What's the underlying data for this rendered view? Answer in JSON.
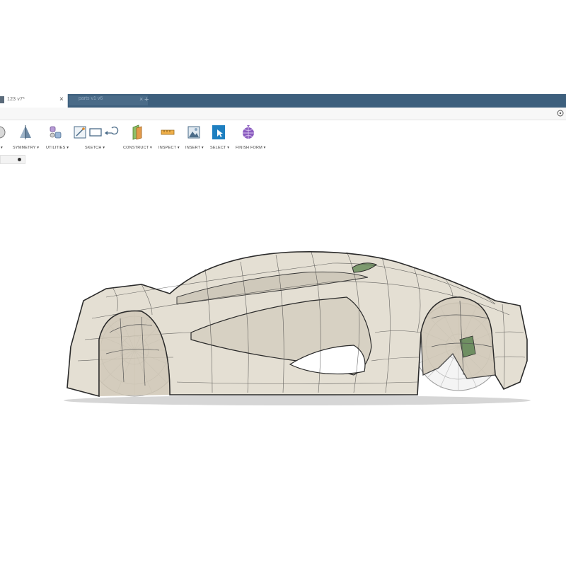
{
  "tabs": {
    "active_label": "123 v7*",
    "inactive_label": "parts v1 v6",
    "close_glyph": "×",
    "add_glyph": "+"
  },
  "toolbar": {
    "groups": [
      {
        "label": "▾",
        "icon": "partial-create-icon"
      },
      {
        "label": "SYMMETRY ▾",
        "icon": "symmetry-icon"
      },
      {
        "label": "UTILITIES ▾",
        "icon": "utilities-icon"
      },
      {
        "label": "SKETCH ▾",
        "icon": "sketch-icon"
      },
      {
        "label": "CONSTRUCT ▾",
        "icon": "construct-icon"
      },
      {
        "label": "INSPECT ▾",
        "icon": "inspect-icon"
      },
      {
        "label": "INSERT ▾",
        "icon": "insert-icon"
      },
      {
        "label": "SELECT ▾",
        "icon": "select-icon"
      },
      {
        "label": "FINISH FORM ▾",
        "icon": "finish-form-icon"
      }
    ]
  },
  "colors": {
    "tabbar": "#3d5f7d",
    "select_blue": "#1e7fc0",
    "finish_form_purple": "#8a5bbf",
    "model_surface": "#e4dfd3",
    "mesh_lines": "#3a3a3a"
  },
  "viewport": {
    "model": "sports-car-tspline-model"
  }
}
